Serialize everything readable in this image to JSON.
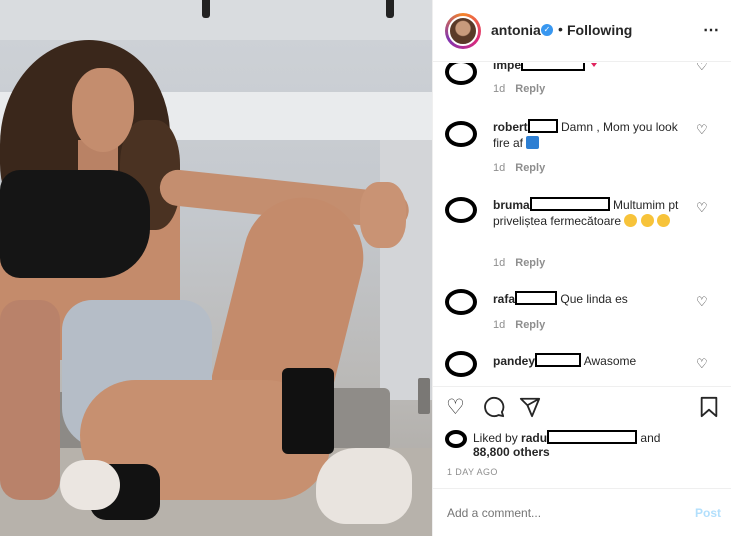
{
  "header": {
    "username": "antonia",
    "separator": "•",
    "follow_status": "Following",
    "more_icon": "⋯"
  },
  "comments": [
    {
      "user": "lmpe",
      "text": "",
      "time": "1d",
      "reply": "Reply"
    },
    {
      "user": "robert",
      "text": "Damn , Mom you look fire af",
      "time": "1d",
      "reply": "Reply"
    },
    {
      "user": "bruma",
      "text": "Multumim pt priveliștea fermecătoare",
      "time": "1d",
      "reply": "Reply"
    },
    {
      "user": "rafa",
      "text": "Que linda es",
      "time": "1d",
      "reply": "Reply"
    },
    {
      "user": "pandey",
      "text": "Awasome",
      "time": "",
      "reply": ""
    }
  ],
  "likes": {
    "prefix": "Liked by",
    "user": "radu",
    "and": "and",
    "others": "88,800 others"
  },
  "time_ago": "1 DAY AGO",
  "add_comment": {
    "placeholder": "Add a comment...",
    "post_label": "Post"
  },
  "colors": {
    "verified": "#3897f0",
    "post_disabled": "#b2dffc",
    "muted": "#8e8e8e"
  }
}
